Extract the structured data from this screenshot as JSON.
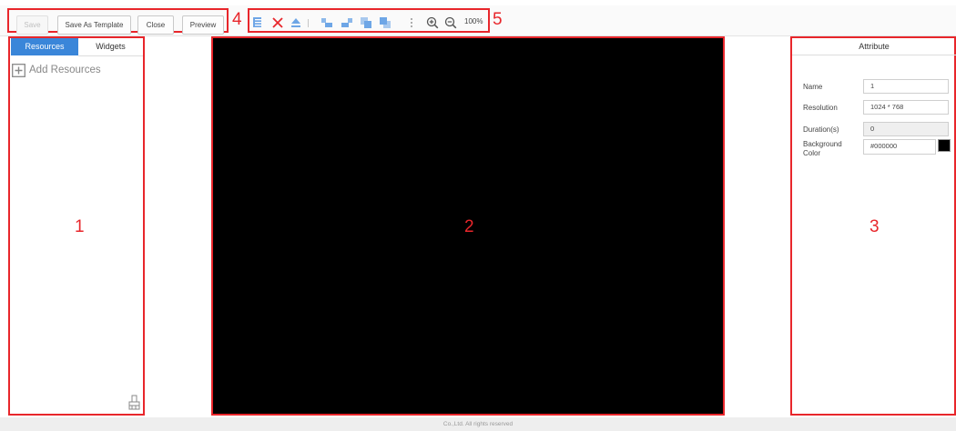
{
  "toolbar": {
    "save_label": "Save",
    "save_as_template_label": "Save As Template",
    "close_label": "Close",
    "preview_label": "Preview",
    "zoom_level": "100%",
    "region_marker_buttons": "4",
    "region_marker_tools": "5"
  },
  "left_panel": {
    "tabs": [
      {
        "label": "Resources",
        "active": true
      },
      {
        "label": "Widgets",
        "active": false
      }
    ],
    "add_resources_label": "Add Resources",
    "region_marker": "1"
  },
  "canvas": {
    "background": "#000000",
    "region_marker": "2"
  },
  "attribute_panel": {
    "title": "Attribute",
    "fields": {
      "name": {
        "label": "Name",
        "value": "1"
      },
      "resolution": {
        "label": "Resolution",
        "value": "1024  *  768"
      },
      "duration": {
        "label": "Duration(s)",
        "value": "0"
      },
      "background_color": {
        "label_line1": "Background",
        "label_line2": "Color",
        "value": "#000000",
        "swatch": "#000000"
      }
    },
    "region_marker": "3"
  },
  "footer": {
    "text": "Co.,Ltd. All rights reserved"
  },
  "colors": {
    "accent": "#3a86d9",
    "annotation_red": "#e8262b"
  },
  "icons": [
    "copy-icon",
    "delete-icon",
    "move-top-icon",
    "align-left-icon",
    "align-right-icon",
    "bring-forward-icon",
    "send-backward-icon",
    "more-icon",
    "zoom-in-icon",
    "zoom-out-icon",
    "plus-icon",
    "eraser-icon"
  ]
}
